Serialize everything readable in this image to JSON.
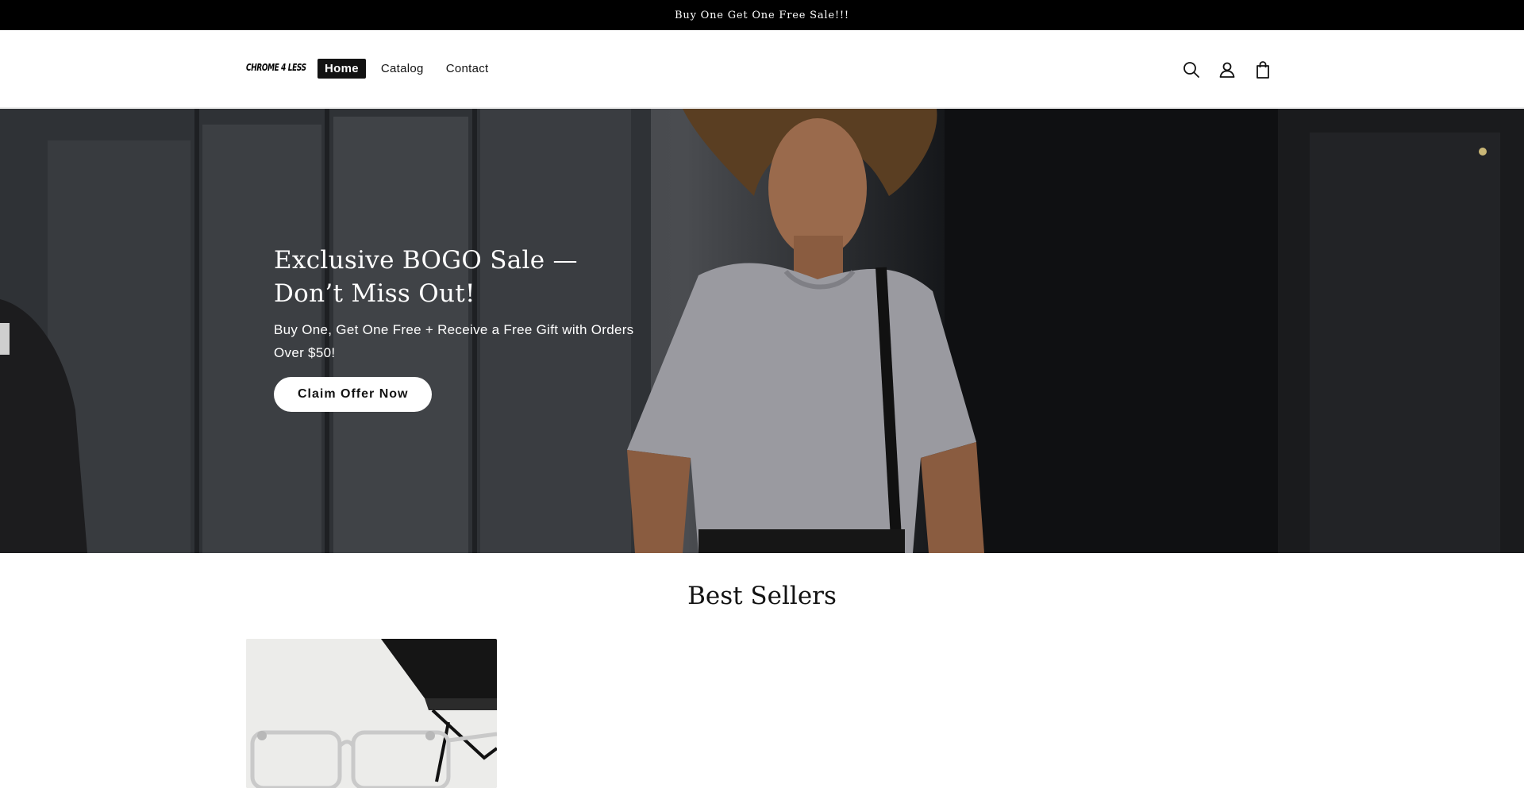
{
  "announcement": {
    "text": "Buy One Get One Free Sale!!!"
  },
  "header": {
    "logo": "CHROME 4 LESS",
    "nav": [
      {
        "label": "Home",
        "active": true
      },
      {
        "label": "Catalog",
        "active": false
      },
      {
        "label": "Contact",
        "active": false
      }
    ],
    "icons": [
      "search-icon",
      "account-icon",
      "cart-icon"
    ]
  },
  "hero": {
    "title": "Exclusive BOGO Sale — Don’t Miss Out!",
    "subtitle": "Buy One, Get One Free + Receive a Free Gift with Orders Over $50!",
    "button_label": "Claim Offer Now"
  },
  "best_sellers": {
    "title": "Best Sellers"
  },
  "colors": {
    "announcement_bg": "#000000",
    "nav_active_bg": "#121212",
    "button_bg": "#ffffff"
  }
}
